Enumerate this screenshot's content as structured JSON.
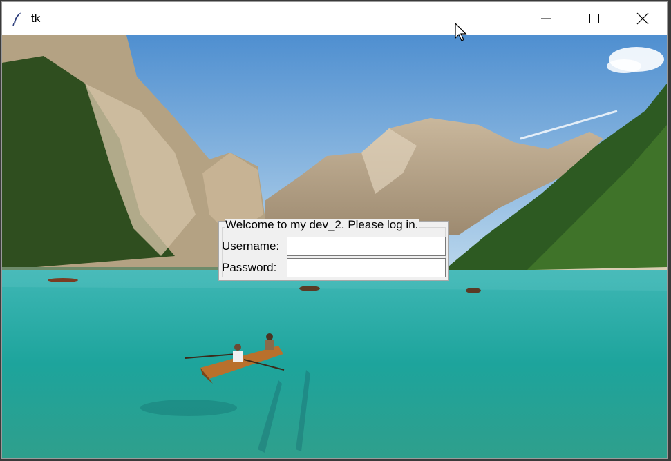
{
  "window": {
    "title": "tk"
  },
  "controls": {
    "minimize": "minimize",
    "maximize": "maximize",
    "close": "close"
  },
  "login": {
    "frame_title": "Welcome to my dev_2. Please log in.",
    "username_label": "Username:",
    "username_value": "",
    "password_label": "Password:",
    "password_value": ""
  },
  "icons": [
    "feather-icon",
    "minimize-icon",
    "maximize-icon",
    "close-icon",
    "mouse-cursor-icon"
  ],
  "colors": {
    "titlebar": "#ffffff",
    "frame_bg": "#f0f0f0",
    "lake": "#1fa7a0",
    "sky": "#6fa8d8"
  }
}
